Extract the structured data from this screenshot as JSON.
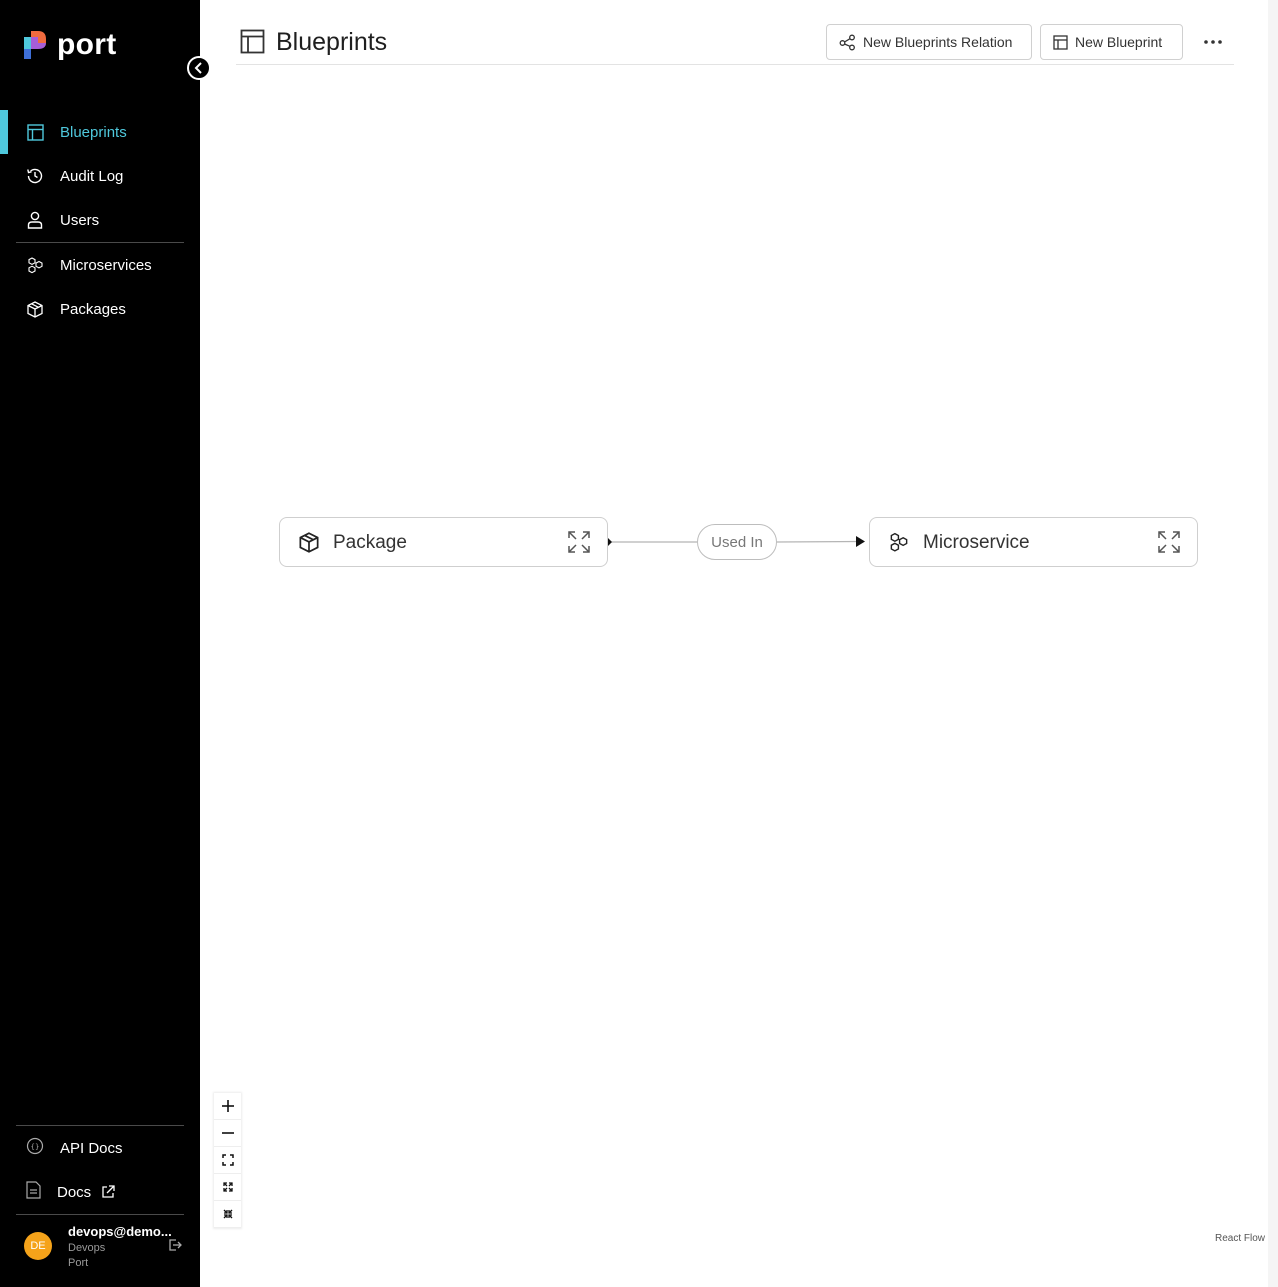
{
  "brand": {
    "name": "port",
    "accent": "#4fc8dc",
    "sidebar_bg": "#000000"
  },
  "sidebar": {
    "items": [
      {
        "label": "Blueprints",
        "icon": "blueprint-icon",
        "active": true
      },
      {
        "label": "Audit Log",
        "icon": "history-icon",
        "active": false
      },
      {
        "label": "Users",
        "icon": "user-icon",
        "active": false
      },
      {
        "label": "Microservices",
        "icon": "microservice-icon",
        "active": false
      },
      {
        "label": "Packages",
        "icon": "package-icon",
        "active": false
      }
    ],
    "bottom_items": [
      {
        "label": "API Docs",
        "icon": "api-icon"
      },
      {
        "label": "Docs",
        "icon": "document-icon",
        "external_icon": "external-link-icon"
      }
    ],
    "user": {
      "initials": "DE",
      "email": "devops@demo...",
      "role": "Devops",
      "org": "Port",
      "avatar_color": "#f5a31a"
    }
  },
  "header": {
    "title": "Blueprints",
    "buttons": {
      "new_relation": "New Blueprints Relation",
      "new_blueprint": "New Blueprint"
    },
    "more_icon": "more-horizontal-icon"
  },
  "graph": {
    "nodes": [
      {
        "label": "Package",
        "icon": "package-icon"
      },
      {
        "label": "Microservice",
        "icon": "microservice-icon"
      }
    ],
    "edge": {
      "label": "Used In",
      "from": "Package",
      "to": "Microservice"
    }
  },
  "controls": [
    "zoom-in-icon",
    "zoom-out-icon",
    "fit-view-icon",
    "expand-icon",
    "collapse-icon"
  ],
  "attribution": "React Flow"
}
